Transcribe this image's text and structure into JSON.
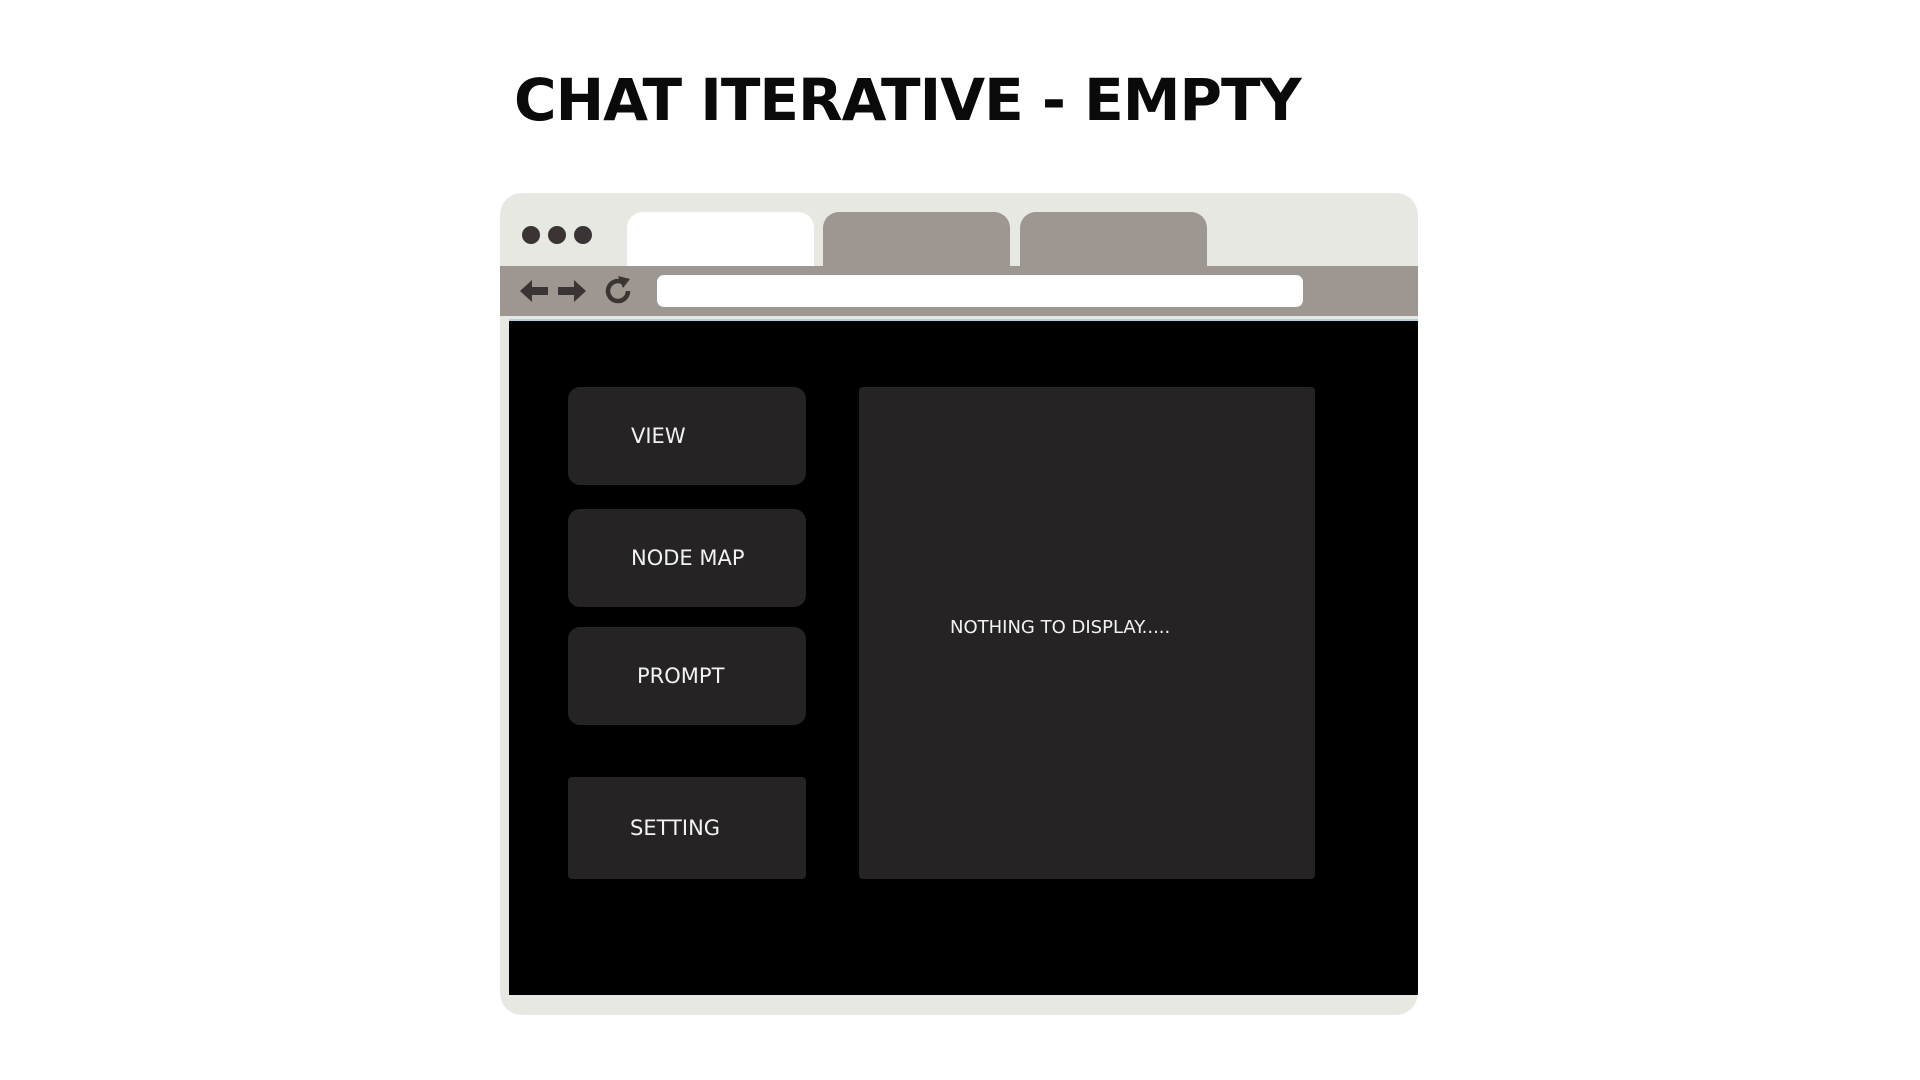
{
  "page": {
    "title": "CHAT ITERATIVE - EMPTY"
  },
  "browser": {
    "tabs": [
      {
        "label": "",
        "active": true
      },
      {
        "label": "",
        "active": false
      },
      {
        "label": "",
        "active": false
      }
    ],
    "address_bar": {
      "value": "",
      "placeholder": ""
    },
    "icons": {
      "window_controls": "traffic-dots",
      "back": "arrow-left-icon",
      "forward": "arrow-right-icon",
      "reload": "reload-icon"
    }
  },
  "app": {
    "sidebar": {
      "view_label": "VIEW",
      "node_map_label": "NODE MAP",
      "prompt_label": "PROMPT",
      "setting_label": "SETTING"
    },
    "display": {
      "empty_message": "NOTHING TO DISPLAY....."
    }
  },
  "colors": {
    "chrome_background": "#e8e8e3",
    "tab_inactive": "#9e9690",
    "toolbar": "#9e9690",
    "viewport_background": "#000000",
    "panel_background": "#252324",
    "icon_color": "#3a3434",
    "text_light": "#f2f2f2"
  }
}
